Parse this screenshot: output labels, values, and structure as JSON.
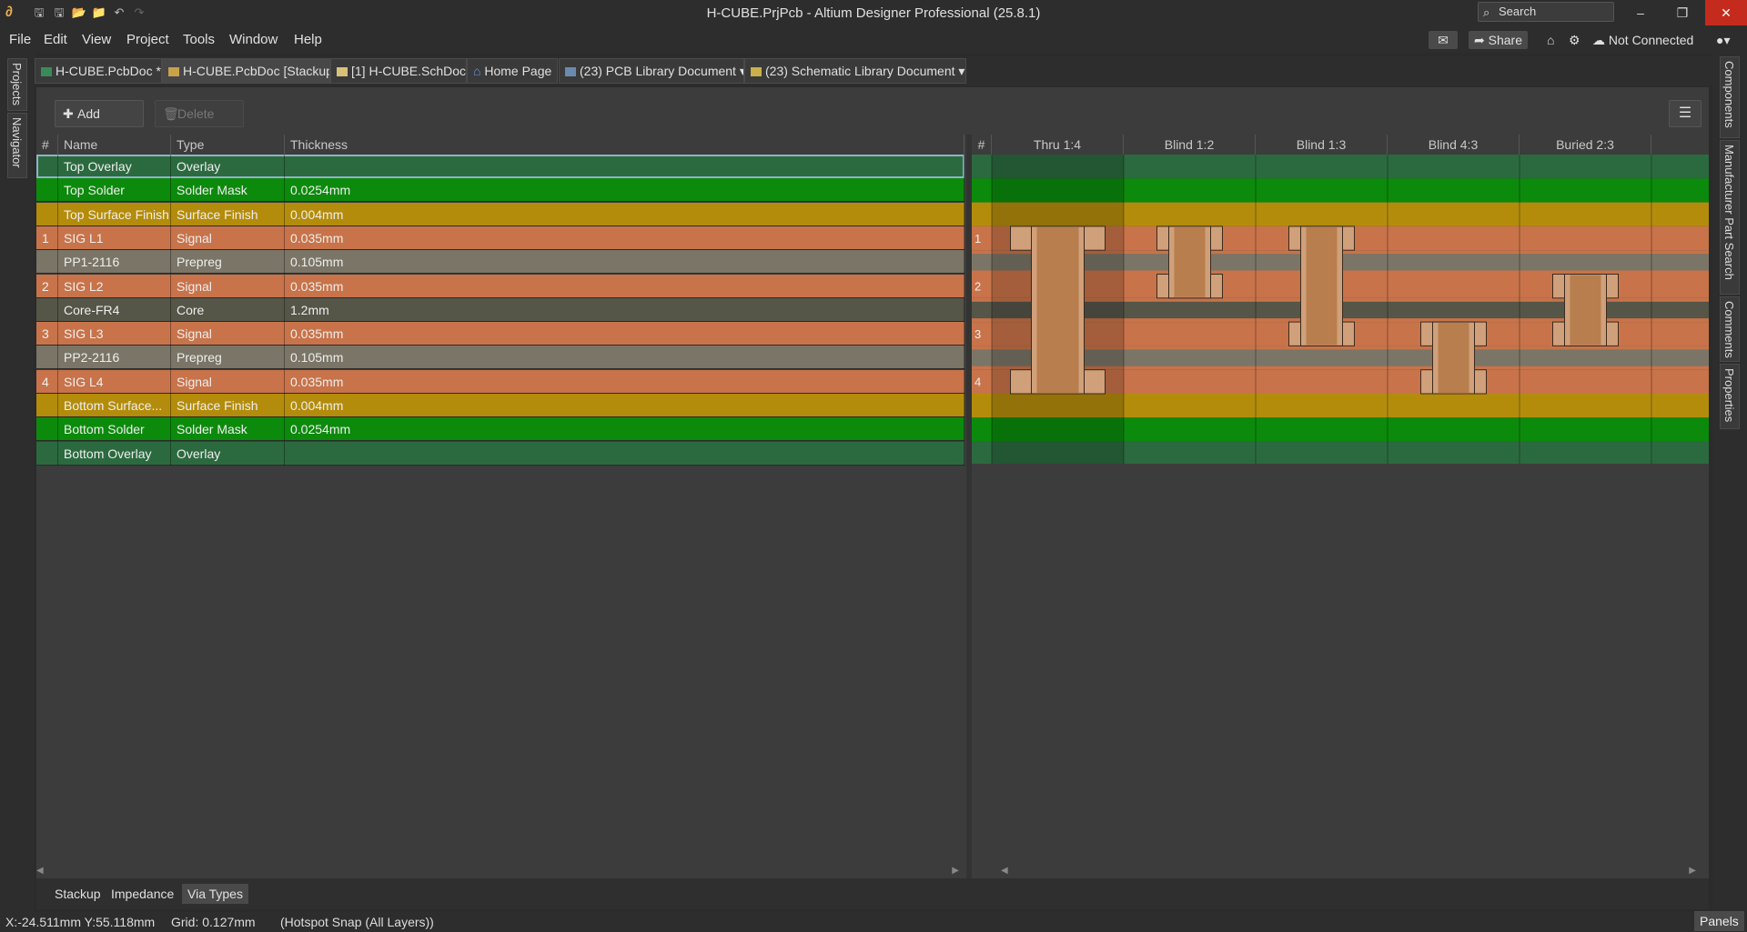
{
  "app": {
    "title": "H-CUBE.PrjPcb - Altium Designer Professional (25.8.1)",
    "search_placeholder": "Search"
  },
  "menu": [
    "File",
    "Edit",
    "View",
    "Project",
    "Tools",
    "Window",
    "Help"
  ],
  "menubar_right": {
    "share": "Share",
    "connection": "Not Connected"
  },
  "left_panels": [
    "Projects",
    "Navigator"
  ],
  "right_panels": [
    "Components",
    "Manufacturer Part Search",
    "Comments",
    "Properties"
  ],
  "doc_tabs": [
    {
      "label": "H-CUBE.PcbDoc *",
      "icon": "pcb-doc-icon",
      "active": false
    },
    {
      "label": "H-CUBE.PcbDoc [Stackup]",
      "icon": "stackup-doc-icon",
      "active": true
    },
    {
      "label": "[1] H-CUBE.SchDoc",
      "icon": "sch-doc-icon",
      "active": false
    },
    {
      "label": "Home Page",
      "icon": "home-icon",
      "active": false
    },
    {
      "label": "(23) PCB Library Document",
      "icon": "pcb-lib-icon",
      "active": false
    },
    {
      "label": "(23) Schematic Library Document",
      "icon": "sch-lib-icon",
      "active": false
    }
  ],
  "toolbar": {
    "add_label": "Add",
    "delete_label": "Delete"
  },
  "colors": {
    "overlay": "#2b6a3f",
    "solder_mask": "#0c8a0c",
    "surface_finish": "#b48c0b",
    "signal": "#c8734a",
    "prepreg": "#7a7566",
    "core": "#555548",
    "via_fill": "#d0a07a",
    "via_barrel": "#b97e4e"
  },
  "stackup": {
    "headers": [
      "#",
      "Name",
      "Type",
      "Thickness"
    ],
    "rows": [
      {
        "num": "",
        "name": "Top Overlay",
        "type": "Overlay",
        "thickness": "",
        "kind": "overlay"
      },
      {
        "num": "",
        "name": "Top Solder",
        "type": "Solder Mask",
        "thickness": "0.0254mm",
        "kind": "solder_mask"
      },
      {
        "num": "",
        "name": "Top Surface Finish",
        "type": "Surface Finish",
        "thickness": "0.004mm",
        "kind": "surface_finish"
      },
      {
        "num": "1",
        "name": "SIG L1",
        "type": "Signal",
        "thickness": "0.035mm",
        "kind": "signal"
      },
      {
        "num": "",
        "name": "PP1-2116",
        "type": "Prepreg",
        "thickness": "0.105mm",
        "kind": "prepreg"
      },
      {
        "num": "2",
        "name": "SIG L2",
        "type": "Signal",
        "thickness": "0.035mm",
        "kind": "signal"
      },
      {
        "num": "",
        "name": "Core-FR4",
        "type": "Core",
        "thickness": "1.2mm",
        "kind": "core"
      },
      {
        "num": "3",
        "name": "SIG L3",
        "type": "Signal",
        "thickness": "0.035mm",
        "kind": "signal"
      },
      {
        "num": "",
        "name": "PP2-2116",
        "type": "Prepreg",
        "thickness": "0.105mm",
        "kind": "prepreg"
      },
      {
        "num": "4",
        "name": "SIG L4",
        "type": "Signal",
        "thickness": "0.035mm",
        "kind": "signal"
      },
      {
        "num": "",
        "name": "Bottom Surface...",
        "type": "Surface Finish",
        "thickness": "0.004mm",
        "kind": "surface_finish"
      },
      {
        "num": "",
        "name": "Bottom Solder",
        "type": "Solder Mask",
        "thickness": "0.0254mm",
        "kind": "solder_mask"
      },
      {
        "num": "",
        "name": "Bottom Overlay",
        "type": "Overlay",
        "thickness": "",
        "kind": "overlay"
      }
    ]
  },
  "via_types": {
    "num_header": "#",
    "columns": [
      {
        "name": "Thru 1:4",
        "from": 1,
        "to": 4
      },
      {
        "name": "Blind 1:2",
        "from": 1,
        "to": 2
      },
      {
        "name": "Blind 1:3",
        "from": 1,
        "to": 3
      },
      {
        "name": "Blind 4:3",
        "from": 3,
        "to": 4
      },
      {
        "name": "Buried 2:3",
        "from": 2,
        "to": 3
      }
    ]
  },
  "bottom_tabs": [
    {
      "label": "Stackup",
      "active": false
    },
    {
      "label": "Impedance",
      "active": false
    },
    {
      "label": "Via Types",
      "active": true
    }
  ],
  "status": {
    "coords": "X:-24.511mm Y:55.118mm",
    "grid": "Grid: 0.127mm",
    "snap": "(Hotspot Snap (All Layers))",
    "panels": "Panels"
  }
}
